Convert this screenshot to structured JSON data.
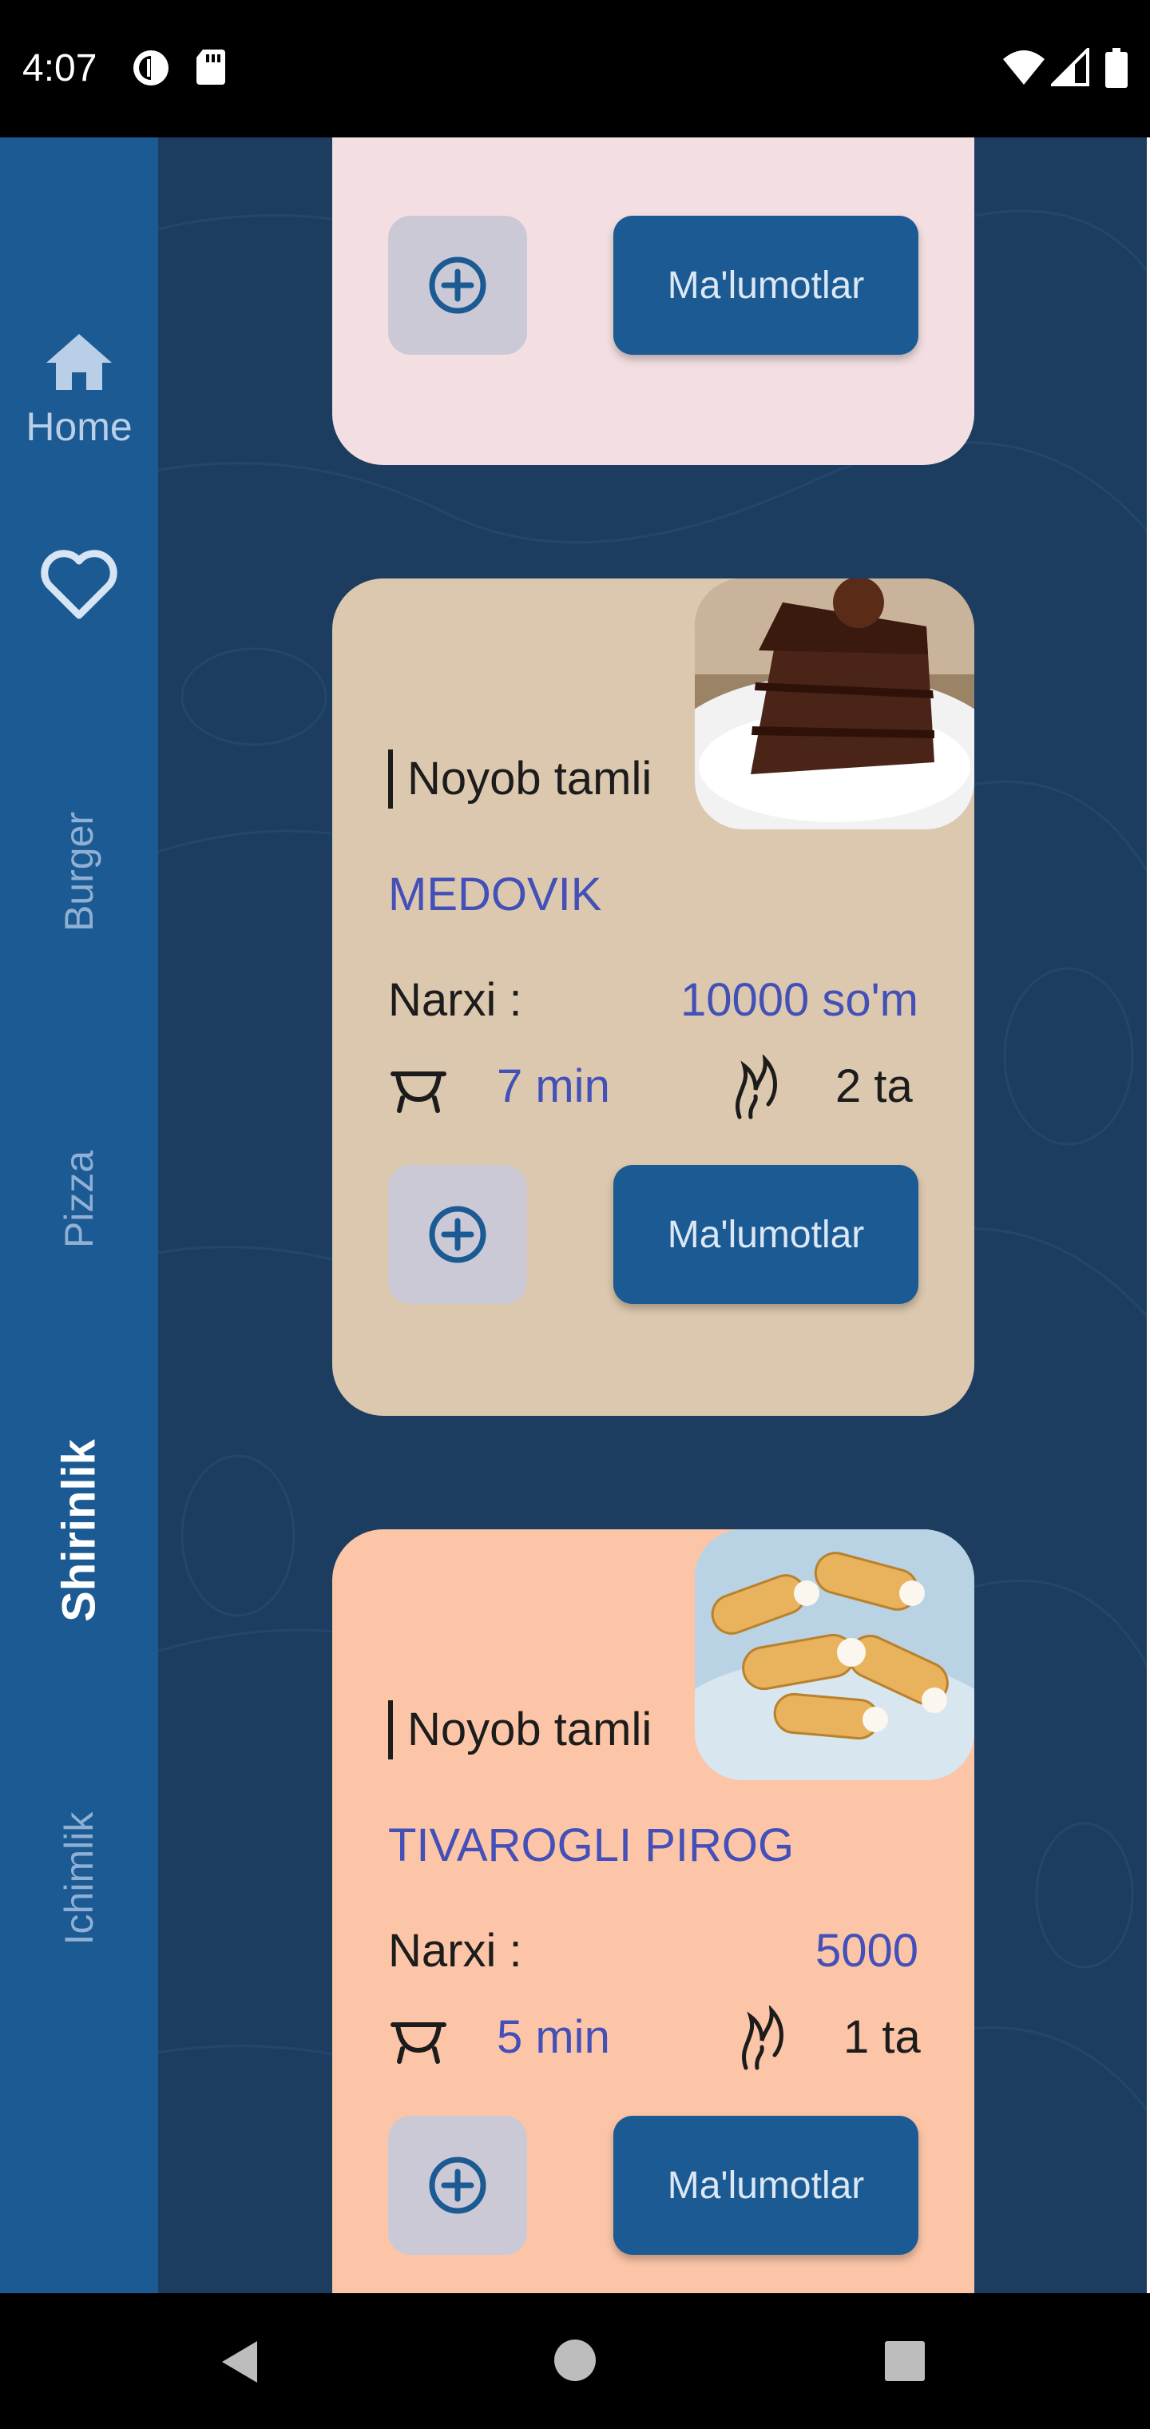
{
  "status_bar": {
    "time": "4:07"
  },
  "sidebar": {
    "home_label": "Home",
    "categories": [
      "Burger",
      "Pizza",
      "Shirinlik",
      "Ichimlik"
    ],
    "active_category": "Shirinlik"
  },
  "cards": [
    {
      "add_icon": "plus-circle-icon",
      "info_label": "Ma'lumotlar",
      "background": "#f3dfe1"
    },
    {
      "tagline": "Noyob tamli",
      "name": "MEDOVIK",
      "price_label": "Narxi :",
      "price": "10000 so'm",
      "time": "7 min",
      "count": "2 ta",
      "info_label": "Ma'lumotlar",
      "image": "chocolate-cake-slice",
      "background": "#dcc8ae"
    },
    {
      "tagline": "Noyob tamli",
      "name": "TIVAROGLI PIROG",
      "price_label": "Narxi :",
      "price": "5000",
      "time": "5 min",
      "count": "1 ta",
      "info_label": "Ma'lumotlar",
      "image": "cream-rolls-pastry",
      "background": "#fcc5a7"
    }
  ],
  "colors": {
    "sidebar": "#1b5a92",
    "background": "#1c3d60",
    "accent_text": "#4350b8",
    "button": "#1b5a92"
  }
}
